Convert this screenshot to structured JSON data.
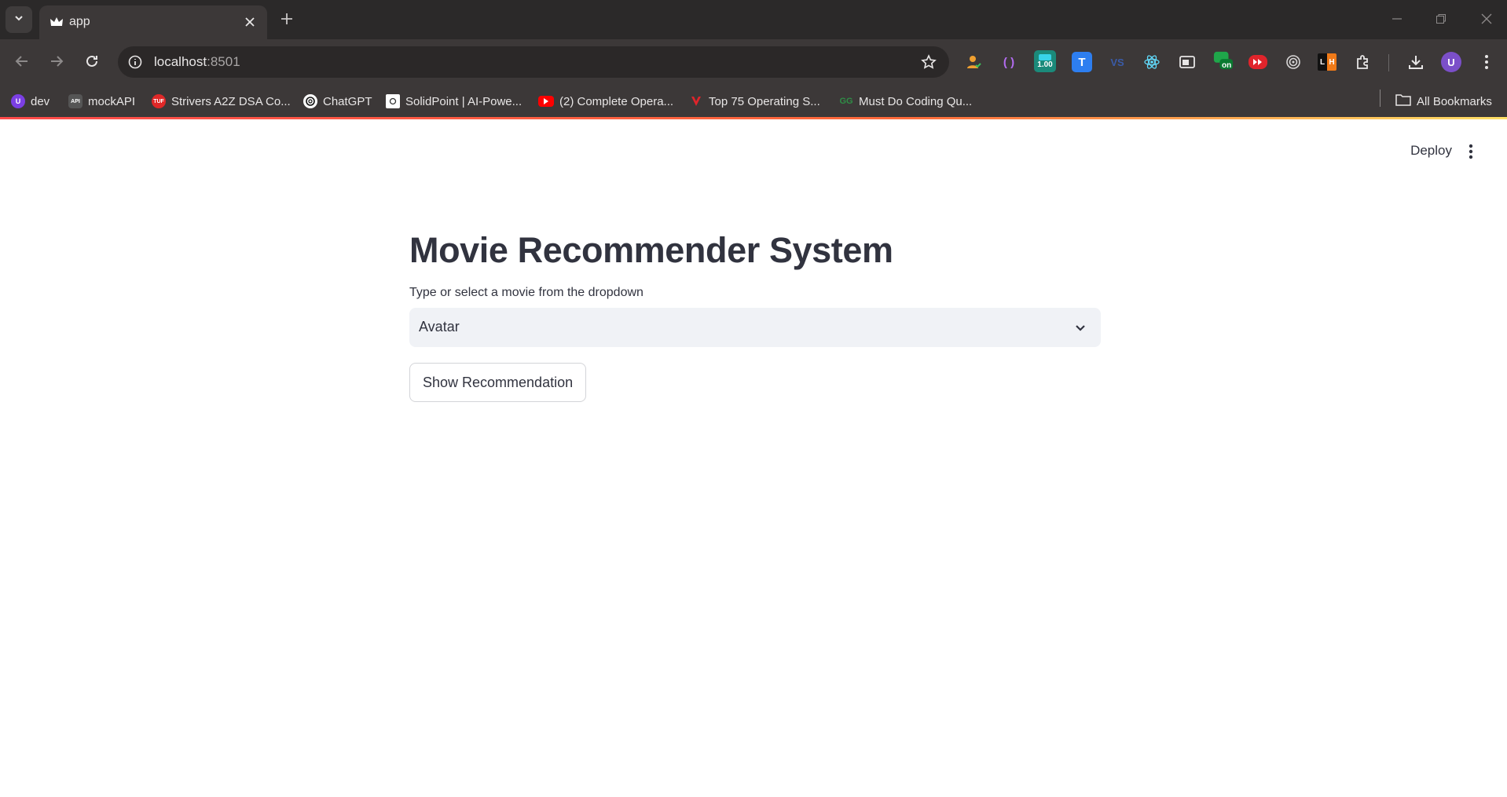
{
  "browser": {
    "tab_title": "app",
    "url_host": "localhost",
    "url_port": ":8501",
    "extension_badge": "1.00",
    "extension_on_badge": "on",
    "profile_initial": "U"
  },
  "bookmarks": [
    {
      "label": "dev",
      "icon": "dev-icon",
      "color": "#7b3fe4"
    },
    {
      "label": "mockAPI",
      "icon": "mockapi-icon",
      "color": "#555555"
    },
    {
      "label": "Strivers A2Z DSA Co...",
      "icon": "tuf-icon",
      "color": "#e02828"
    },
    {
      "label": "ChatGPT",
      "icon": "chatgpt-icon",
      "color": "#ffffff"
    },
    {
      "label": "SolidPoint | AI-Powe...",
      "icon": "solidpoint-icon",
      "color": "#ffffff"
    },
    {
      "label": "(2) Complete Opera...",
      "icon": "youtube-icon",
      "color": "#ff0000"
    },
    {
      "label": "Top 75 Operating S...",
      "icon": "v-icon",
      "color": "#e0242b"
    },
    {
      "label": "Must Do Coding Qu...",
      "icon": "gfg-icon",
      "color": "#2f8d46"
    }
  ],
  "all_bookmarks_label": "All Bookmarks",
  "header": {
    "deploy_label": "Deploy"
  },
  "main": {
    "title": "Movie Recommender System",
    "select_label": "Type or select a movie from the dropdown",
    "select_value": "Avatar",
    "button_label": "Show Recommendation"
  },
  "colors": {
    "accent_gradient": [
      "#ff4b4b",
      "#ffe066"
    ],
    "text": "#31333f",
    "select_bg": "#f0f2f6"
  }
}
